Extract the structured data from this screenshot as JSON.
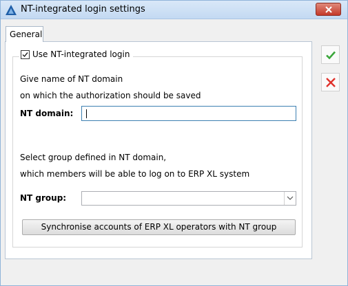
{
  "window": {
    "title": "NT-integrated login settings",
    "close_icon": "close-icon"
  },
  "tabs": [
    {
      "label": "General",
      "selected": true
    }
  ],
  "group": {
    "checkbox_label": "Use NT-integrated login",
    "checkbox_checked": true
  },
  "domain_section": {
    "line1": "Give name of NT domain",
    "line2": "on which the authorization should be saved",
    "field_label": "NT domain:",
    "field_value": ""
  },
  "group_section": {
    "line1": "Select group defined in NT domain,",
    "line2": "which members will be able to log on to ERP XL system",
    "field_label": "NT group:",
    "selected_value": ""
  },
  "sync_button_label": "Synchronise accounts of ERP XL operators with NT group",
  "side_buttons": {
    "ok_icon": "checkmark-icon",
    "cancel_icon": "cancel-x-icon"
  },
  "colors": {
    "ok": "#3aa63a",
    "cancel": "#e0312b",
    "accent": "#3c7fb1"
  }
}
